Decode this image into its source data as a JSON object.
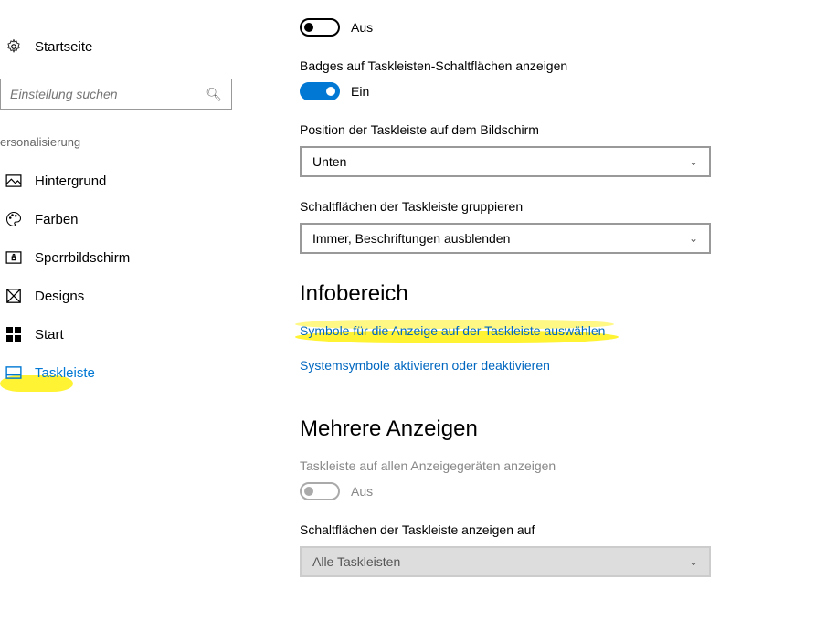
{
  "sidebar": {
    "startpage_label": "Startseite",
    "search_placeholder": "Einstellung suchen",
    "category_label": "ersonalisierung",
    "items": [
      {
        "label": "Hintergrund"
      },
      {
        "label": "Farben"
      },
      {
        "label": "Sperrbildschirm"
      },
      {
        "label": "Designs"
      },
      {
        "label": "Start"
      },
      {
        "label": "Taskleiste"
      }
    ]
  },
  "main": {
    "toggle1": {
      "state": "Aus"
    },
    "badges": {
      "label": "Badges auf Taskleisten-Schaltflächen anzeigen",
      "state": "Ein"
    },
    "position": {
      "label": "Position der Taskleiste auf dem Bildschirm",
      "value": "Unten"
    },
    "grouping": {
      "label": "Schaltflächen der Taskleiste gruppieren",
      "value": "Immer, Beschriftungen ausblenden"
    },
    "infobereich": {
      "title": "Infobereich",
      "link1": "Symbole für die Anzeige auf der Taskleiste auswählen",
      "link2": "Systemsymbole aktivieren oder deaktivieren"
    },
    "multi": {
      "title": "Mehrere Anzeigen",
      "label": "Taskleiste auf allen Anzeigegeräten anzeigen",
      "state": "Aus",
      "buttons_label": "Schaltflächen der Taskleiste anzeigen auf",
      "buttons_value": "Alle Taskleisten"
    }
  }
}
